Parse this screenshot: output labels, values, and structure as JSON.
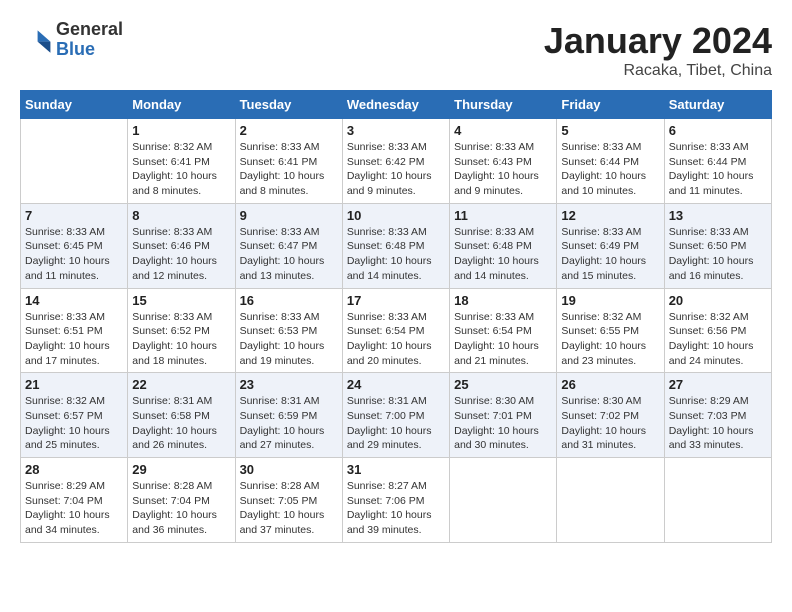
{
  "header": {
    "logo_general": "General",
    "logo_blue": "Blue",
    "month_title": "January 2024",
    "location": "Racaka, Tibet, China"
  },
  "days_of_week": [
    "Sunday",
    "Monday",
    "Tuesday",
    "Wednesday",
    "Thursday",
    "Friday",
    "Saturday"
  ],
  "weeks": [
    [
      {
        "num": "",
        "info": ""
      },
      {
        "num": "1",
        "info": "Sunrise: 8:32 AM\nSunset: 6:41 PM\nDaylight: 10 hours\nand 8 minutes."
      },
      {
        "num": "2",
        "info": "Sunrise: 8:33 AM\nSunset: 6:41 PM\nDaylight: 10 hours\nand 8 minutes."
      },
      {
        "num": "3",
        "info": "Sunrise: 8:33 AM\nSunset: 6:42 PM\nDaylight: 10 hours\nand 9 minutes."
      },
      {
        "num": "4",
        "info": "Sunrise: 8:33 AM\nSunset: 6:43 PM\nDaylight: 10 hours\nand 9 minutes."
      },
      {
        "num": "5",
        "info": "Sunrise: 8:33 AM\nSunset: 6:44 PM\nDaylight: 10 hours\nand 10 minutes."
      },
      {
        "num": "6",
        "info": "Sunrise: 8:33 AM\nSunset: 6:44 PM\nDaylight: 10 hours\nand 11 minutes."
      }
    ],
    [
      {
        "num": "7",
        "info": "Sunrise: 8:33 AM\nSunset: 6:45 PM\nDaylight: 10 hours\nand 11 minutes."
      },
      {
        "num": "8",
        "info": "Sunrise: 8:33 AM\nSunset: 6:46 PM\nDaylight: 10 hours\nand 12 minutes."
      },
      {
        "num": "9",
        "info": "Sunrise: 8:33 AM\nSunset: 6:47 PM\nDaylight: 10 hours\nand 13 minutes."
      },
      {
        "num": "10",
        "info": "Sunrise: 8:33 AM\nSunset: 6:48 PM\nDaylight: 10 hours\nand 14 minutes."
      },
      {
        "num": "11",
        "info": "Sunrise: 8:33 AM\nSunset: 6:48 PM\nDaylight: 10 hours\nand 14 minutes."
      },
      {
        "num": "12",
        "info": "Sunrise: 8:33 AM\nSunset: 6:49 PM\nDaylight: 10 hours\nand 15 minutes."
      },
      {
        "num": "13",
        "info": "Sunrise: 8:33 AM\nSunset: 6:50 PM\nDaylight: 10 hours\nand 16 minutes."
      }
    ],
    [
      {
        "num": "14",
        "info": "Sunrise: 8:33 AM\nSunset: 6:51 PM\nDaylight: 10 hours\nand 17 minutes."
      },
      {
        "num": "15",
        "info": "Sunrise: 8:33 AM\nSunset: 6:52 PM\nDaylight: 10 hours\nand 18 minutes."
      },
      {
        "num": "16",
        "info": "Sunrise: 8:33 AM\nSunset: 6:53 PM\nDaylight: 10 hours\nand 19 minutes."
      },
      {
        "num": "17",
        "info": "Sunrise: 8:33 AM\nSunset: 6:54 PM\nDaylight: 10 hours\nand 20 minutes."
      },
      {
        "num": "18",
        "info": "Sunrise: 8:33 AM\nSunset: 6:54 PM\nDaylight: 10 hours\nand 21 minutes."
      },
      {
        "num": "19",
        "info": "Sunrise: 8:32 AM\nSunset: 6:55 PM\nDaylight: 10 hours\nand 23 minutes."
      },
      {
        "num": "20",
        "info": "Sunrise: 8:32 AM\nSunset: 6:56 PM\nDaylight: 10 hours\nand 24 minutes."
      }
    ],
    [
      {
        "num": "21",
        "info": "Sunrise: 8:32 AM\nSunset: 6:57 PM\nDaylight: 10 hours\nand 25 minutes."
      },
      {
        "num": "22",
        "info": "Sunrise: 8:31 AM\nSunset: 6:58 PM\nDaylight: 10 hours\nand 26 minutes."
      },
      {
        "num": "23",
        "info": "Sunrise: 8:31 AM\nSunset: 6:59 PM\nDaylight: 10 hours\nand 27 minutes."
      },
      {
        "num": "24",
        "info": "Sunrise: 8:31 AM\nSunset: 7:00 PM\nDaylight: 10 hours\nand 29 minutes."
      },
      {
        "num": "25",
        "info": "Sunrise: 8:30 AM\nSunset: 7:01 PM\nDaylight: 10 hours\nand 30 minutes."
      },
      {
        "num": "26",
        "info": "Sunrise: 8:30 AM\nSunset: 7:02 PM\nDaylight: 10 hours\nand 31 minutes."
      },
      {
        "num": "27",
        "info": "Sunrise: 8:29 AM\nSunset: 7:03 PM\nDaylight: 10 hours\nand 33 minutes."
      }
    ],
    [
      {
        "num": "28",
        "info": "Sunrise: 8:29 AM\nSunset: 7:04 PM\nDaylight: 10 hours\nand 34 minutes."
      },
      {
        "num": "29",
        "info": "Sunrise: 8:28 AM\nSunset: 7:04 PM\nDaylight: 10 hours\nand 36 minutes."
      },
      {
        "num": "30",
        "info": "Sunrise: 8:28 AM\nSunset: 7:05 PM\nDaylight: 10 hours\nand 37 minutes."
      },
      {
        "num": "31",
        "info": "Sunrise: 8:27 AM\nSunset: 7:06 PM\nDaylight: 10 hours\nand 39 minutes."
      },
      {
        "num": "",
        "info": ""
      },
      {
        "num": "",
        "info": ""
      },
      {
        "num": "",
        "info": ""
      }
    ]
  ]
}
